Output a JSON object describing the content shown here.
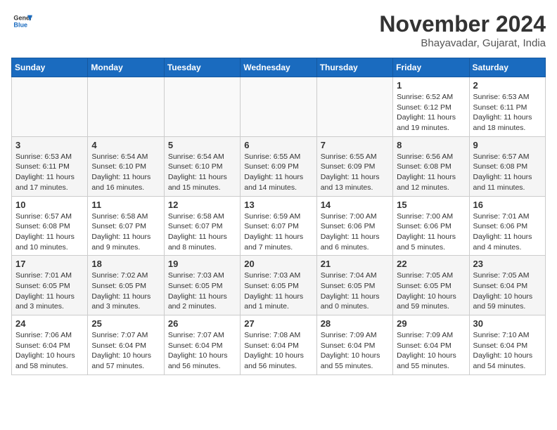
{
  "header": {
    "logo_line1": "General",
    "logo_line2": "Blue",
    "month": "November 2024",
    "location": "Bhayavadar, Gujarat, India"
  },
  "columns": [
    "Sunday",
    "Monday",
    "Tuesday",
    "Wednesday",
    "Thursday",
    "Friday",
    "Saturday"
  ],
  "weeks": [
    [
      {
        "day": "",
        "info": ""
      },
      {
        "day": "",
        "info": ""
      },
      {
        "day": "",
        "info": ""
      },
      {
        "day": "",
        "info": ""
      },
      {
        "day": "",
        "info": ""
      },
      {
        "day": "1",
        "info": "Sunrise: 6:52 AM\nSunset: 6:12 PM\nDaylight: 11 hours and 19 minutes."
      },
      {
        "day": "2",
        "info": "Sunrise: 6:53 AM\nSunset: 6:11 PM\nDaylight: 11 hours and 18 minutes."
      }
    ],
    [
      {
        "day": "3",
        "info": "Sunrise: 6:53 AM\nSunset: 6:11 PM\nDaylight: 11 hours and 17 minutes."
      },
      {
        "day": "4",
        "info": "Sunrise: 6:54 AM\nSunset: 6:10 PM\nDaylight: 11 hours and 16 minutes."
      },
      {
        "day": "5",
        "info": "Sunrise: 6:54 AM\nSunset: 6:10 PM\nDaylight: 11 hours and 15 minutes."
      },
      {
        "day": "6",
        "info": "Sunrise: 6:55 AM\nSunset: 6:09 PM\nDaylight: 11 hours and 14 minutes."
      },
      {
        "day": "7",
        "info": "Sunrise: 6:55 AM\nSunset: 6:09 PM\nDaylight: 11 hours and 13 minutes."
      },
      {
        "day": "8",
        "info": "Sunrise: 6:56 AM\nSunset: 6:08 PM\nDaylight: 11 hours and 12 minutes."
      },
      {
        "day": "9",
        "info": "Sunrise: 6:57 AM\nSunset: 6:08 PM\nDaylight: 11 hours and 11 minutes."
      }
    ],
    [
      {
        "day": "10",
        "info": "Sunrise: 6:57 AM\nSunset: 6:08 PM\nDaylight: 11 hours and 10 minutes."
      },
      {
        "day": "11",
        "info": "Sunrise: 6:58 AM\nSunset: 6:07 PM\nDaylight: 11 hours and 9 minutes."
      },
      {
        "day": "12",
        "info": "Sunrise: 6:58 AM\nSunset: 6:07 PM\nDaylight: 11 hours and 8 minutes."
      },
      {
        "day": "13",
        "info": "Sunrise: 6:59 AM\nSunset: 6:07 PM\nDaylight: 11 hours and 7 minutes."
      },
      {
        "day": "14",
        "info": "Sunrise: 7:00 AM\nSunset: 6:06 PM\nDaylight: 11 hours and 6 minutes."
      },
      {
        "day": "15",
        "info": "Sunrise: 7:00 AM\nSunset: 6:06 PM\nDaylight: 11 hours and 5 minutes."
      },
      {
        "day": "16",
        "info": "Sunrise: 7:01 AM\nSunset: 6:06 PM\nDaylight: 11 hours and 4 minutes."
      }
    ],
    [
      {
        "day": "17",
        "info": "Sunrise: 7:01 AM\nSunset: 6:05 PM\nDaylight: 11 hours and 3 minutes."
      },
      {
        "day": "18",
        "info": "Sunrise: 7:02 AM\nSunset: 6:05 PM\nDaylight: 11 hours and 3 minutes."
      },
      {
        "day": "19",
        "info": "Sunrise: 7:03 AM\nSunset: 6:05 PM\nDaylight: 11 hours and 2 minutes."
      },
      {
        "day": "20",
        "info": "Sunrise: 7:03 AM\nSunset: 6:05 PM\nDaylight: 11 hours and 1 minute."
      },
      {
        "day": "21",
        "info": "Sunrise: 7:04 AM\nSunset: 6:05 PM\nDaylight: 11 hours and 0 minutes."
      },
      {
        "day": "22",
        "info": "Sunrise: 7:05 AM\nSunset: 6:05 PM\nDaylight: 10 hours and 59 minutes."
      },
      {
        "day": "23",
        "info": "Sunrise: 7:05 AM\nSunset: 6:04 PM\nDaylight: 10 hours and 59 minutes."
      }
    ],
    [
      {
        "day": "24",
        "info": "Sunrise: 7:06 AM\nSunset: 6:04 PM\nDaylight: 10 hours and 58 minutes."
      },
      {
        "day": "25",
        "info": "Sunrise: 7:07 AM\nSunset: 6:04 PM\nDaylight: 10 hours and 57 minutes."
      },
      {
        "day": "26",
        "info": "Sunrise: 7:07 AM\nSunset: 6:04 PM\nDaylight: 10 hours and 56 minutes."
      },
      {
        "day": "27",
        "info": "Sunrise: 7:08 AM\nSunset: 6:04 PM\nDaylight: 10 hours and 56 minutes."
      },
      {
        "day": "28",
        "info": "Sunrise: 7:09 AM\nSunset: 6:04 PM\nDaylight: 10 hours and 55 minutes."
      },
      {
        "day": "29",
        "info": "Sunrise: 7:09 AM\nSunset: 6:04 PM\nDaylight: 10 hours and 55 minutes."
      },
      {
        "day": "30",
        "info": "Sunrise: 7:10 AM\nSunset: 6:04 PM\nDaylight: 10 hours and 54 minutes."
      }
    ]
  ]
}
